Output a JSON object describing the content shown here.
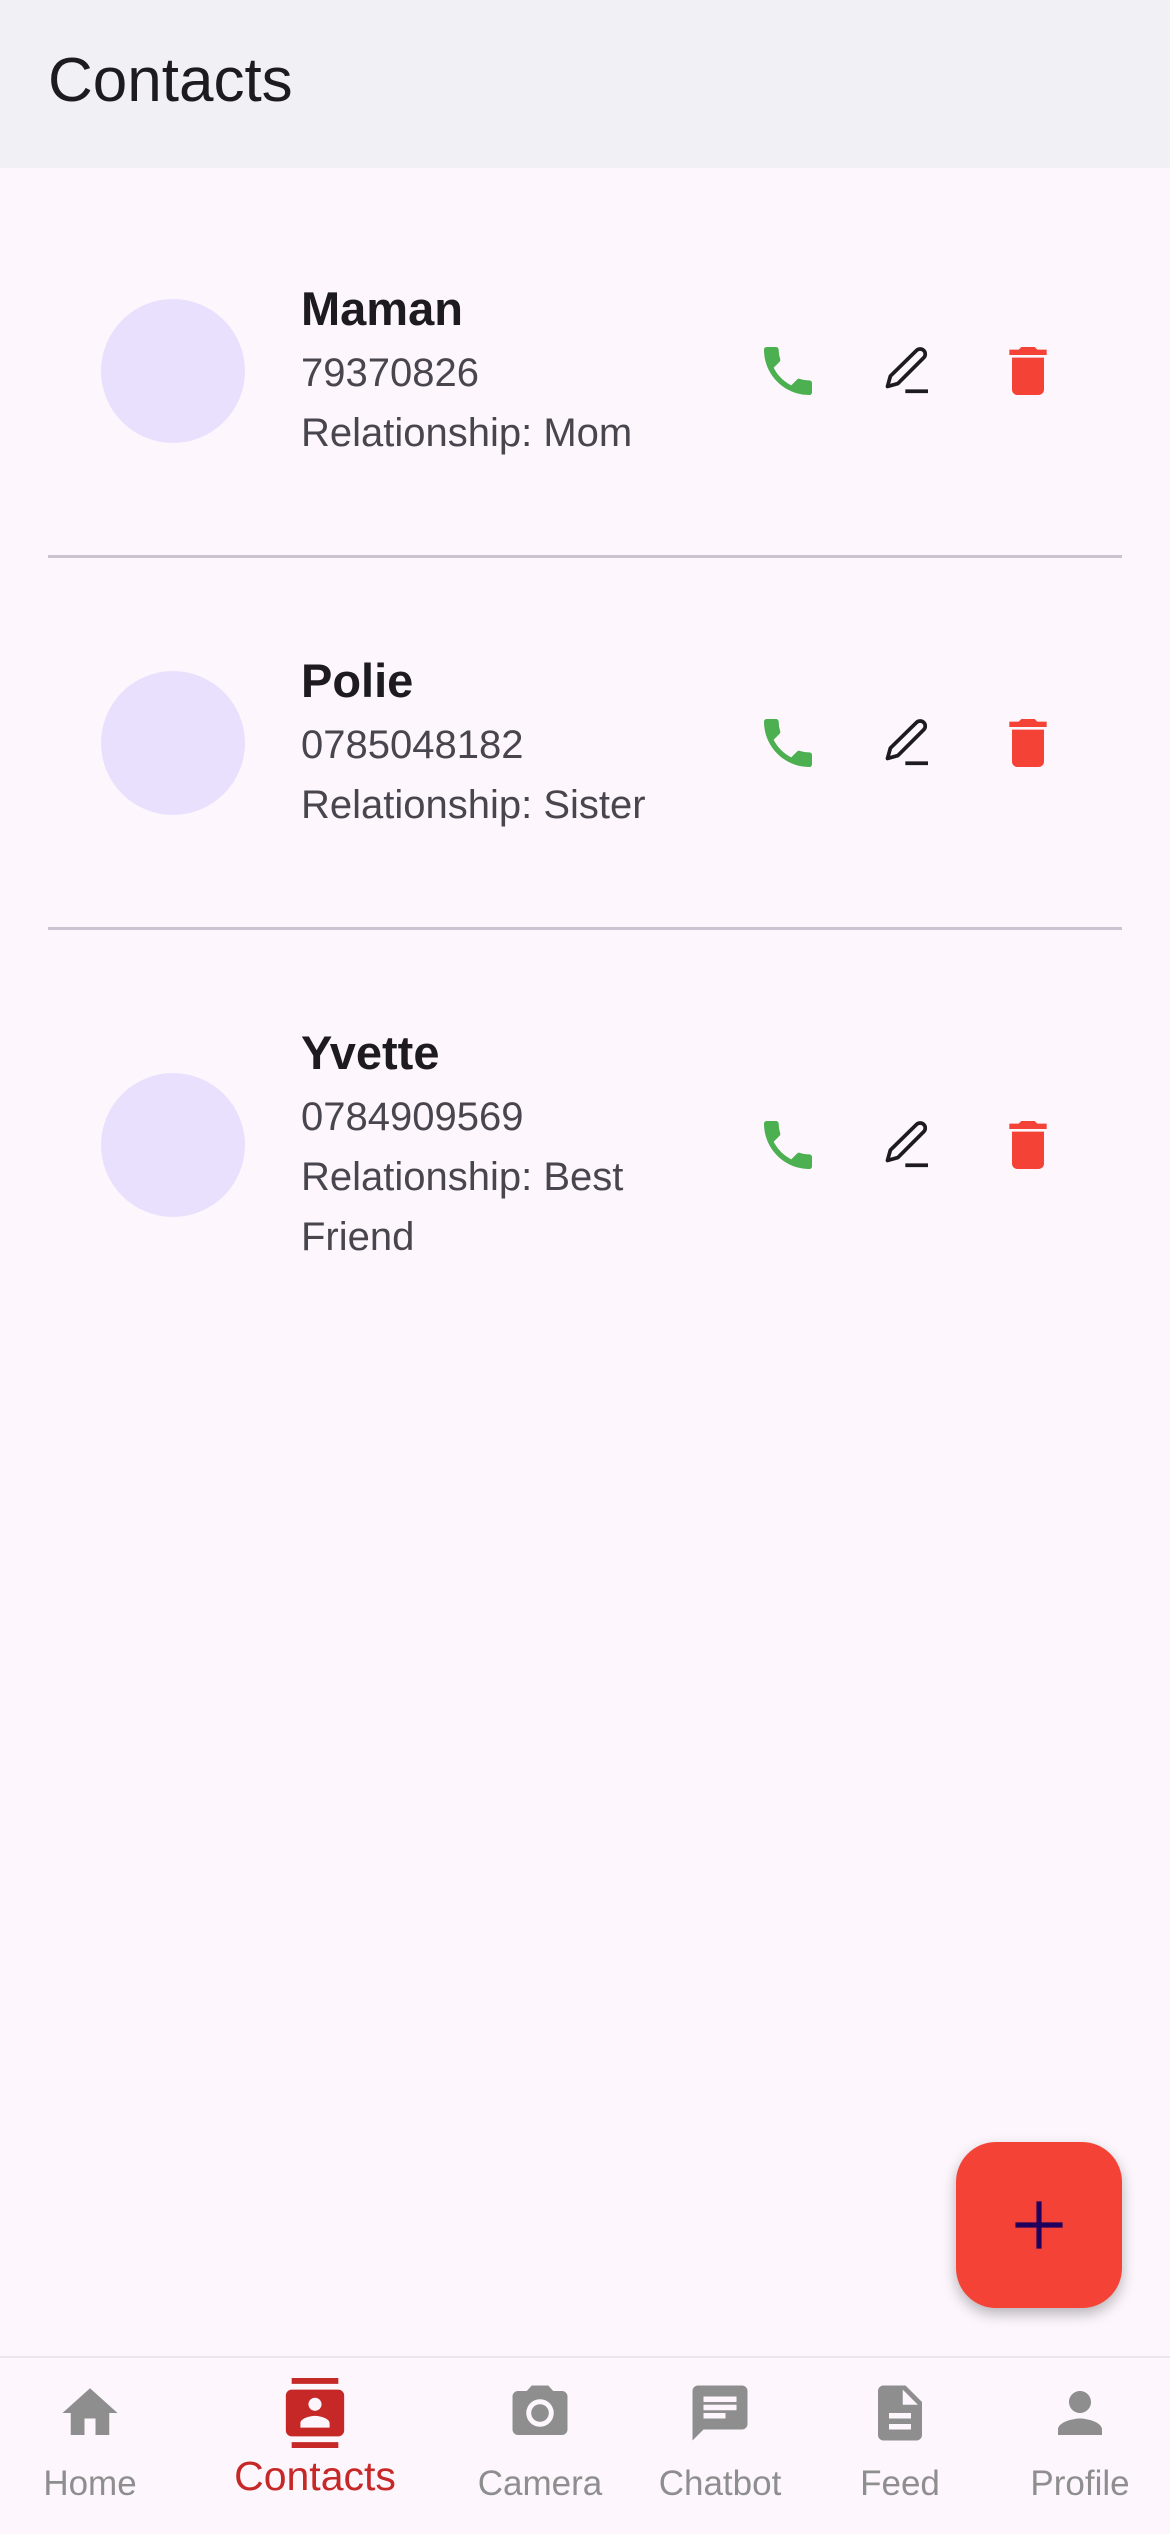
{
  "appbar": {
    "title": "Contacts"
  },
  "contacts": [
    {
      "name": "Maman",
      "phone": "79370826",
      "relationship_line1": "Relationship: Mom",
      "relationship_line2": ""
    },
    {
      "name": "Polie",
      "phone": "0785048182",
      "relationship_line1": "Relationship: Sister",
      "relationship_line2": ""
    },
    {
      "name": "Yvette",
      "phone": "0784909569",
      "relationship_line1": "Relationship: Best",
      "relationship_line2": "Friend"
    }
  ],
  "icons": {
    "call": "phone-icon",
    "edit": "pencil-icon",
    "delete": "trash-icon",
    "add": "plus-icon"
  },
  "colors": {
    "call": "#4caf50",
    "delete": "#f44336",
    "fab": "#f44336",
    "active_nav": "#c62828",
    "inactive_nav": "#8e8e8e"
  },
  "nav": {
    "items": [
      {
        "label": "Home",
        "icon": "home-icon"
      },
      {
        "label": "Contacts",
        "icon": "contacts-icon",
        "active": true
      },
      {
        "label": "Camera",
        "icon": "camera-icon"
      },
      {
        "label": "Chatbot",
        "icon": "chat-icon"
      },
      {
        "label": "Feed",
        "icon": "document-icon"
      },
      {
        "label": "Profile",
        "icon": "person-icon"
      }
    ]
  }
}
